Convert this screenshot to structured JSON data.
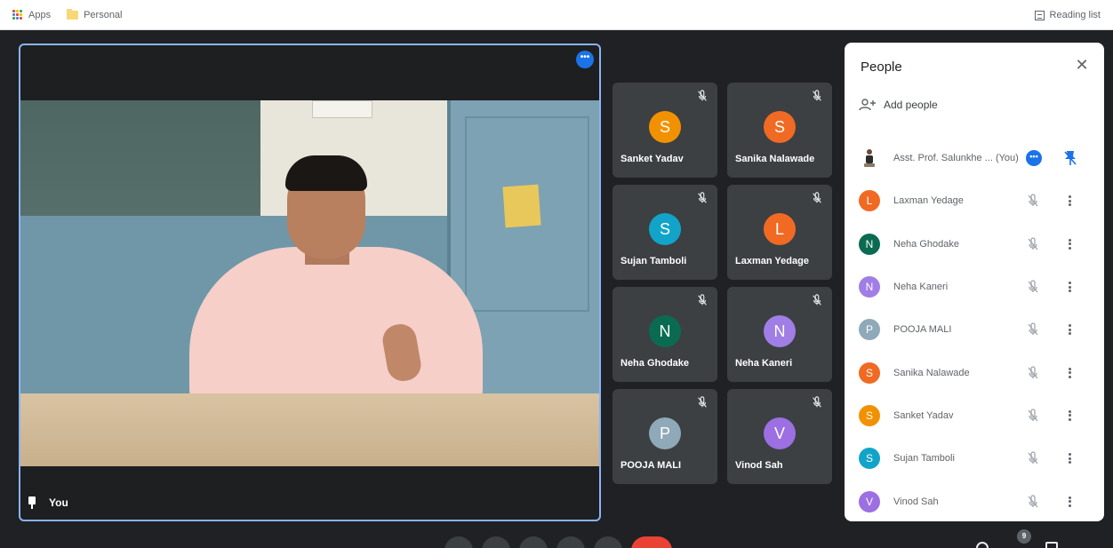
{
  "bookmarks": {
    "apps_label": "Apps",
    "personal_label": "Personal",
    "reading_list_label": "Reading list"
  },
  "main_video": {
    "self_label": "You",
    "more_options_glyph": "•••"
  },
  "tiles": [
    {
      "name": "Sanket Yadav",
      "initial": "S",
      "color": "#f29100"
    },
    {
      "name": "Sanika Nalawade",
      "initial": "S",
      "color": "#f06a24"
    },
    {
      "name": "Sujan Tamboli",
      "initial": "S",
      "color": "#12a4c8"
    },
    {
      "name": "Laxman Yedage",
      "initial": "L",
      "color": "#f06a24"
    },
    {
      "name": "Neha Ghodake",
      "initial": "N",
      "color": "#0b6b52"
    },
    {
      "name": "Neha Kaneri",
      "initial": "N",
      "color": "#a07ee6"
    },
    {
      "name": "POOJA MALI",
      "initial": "P",
      "color": "#8fa9b8"
    },
    {
      "name": "Vinod Sah",
      "initial": "V",
      "color": "#9c6fe3"
    }
  ],
  "people_panel": {
    "title": "People",
    "close_glyph": "✕",
    "add_people_label": "Add people",
    "host": {
      "name": "Asst. Prof. Salunkhe ... (You)",
      "more_glyph": "•••"
    },
    "participants": [
      {
        "name": "Laxman Yedage",
        "initial": "L",
        "color": "#f06a24"
      },
      {
        "name": "Neha Ghodake",
        "initial": "N",
        "color": "#0b6b52"
      },
      {
        "name": "Neha Kaneri",
        "initial": "N",
        "color": "#a07ee6"
      },
      {
        "name": "POOJA MALI",
        "initial": "P",
        "color": "#8fa9b8"
      },
      {
        "name": "Sanika Nalawade",
        "initial": "S",
        "color": "#f06a24"
      },
      {
        "name": "Sanket Yadav",
        "initial": "S",
        "color": "#f29100"
      },
      {
        "name": "Sujan Tamboli",
        "initial": "S",
        "color": "#12a4c8"
      },
      {
        "name": "Vinod Sah",
        "initial": "V",
        "color": "#9c6fe3"
      }
    ]
  },
  "bottom_bar": {
    "participant_count": "9"
  },
  "colors": {
    "accent": "#1a73e8",
    "border_highlight": "#8ab4f8",
    "end_call": "#ea4335",
    "tile_bg": "#3c4043"
  },
  "icons": {
    "apps": "apps-grid-icon",
    "folder": "folder-icon",
    "reading_list": "reading-list-icon",
    "mic_off": "mic-off-icon",
    "pin": "pin-icon",
    "add_person": "add-person-icon",
    "close": "close-icon",
    "more_vert": "more-vert-icon"
  }
}
